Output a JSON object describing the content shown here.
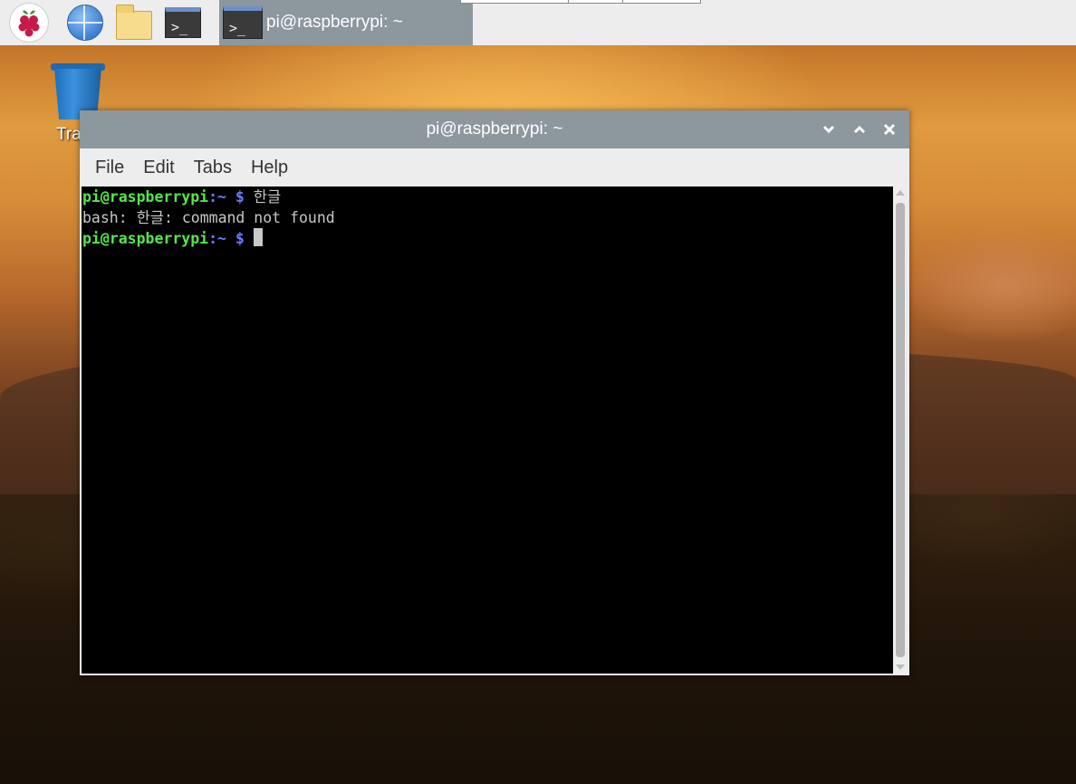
{
  "taskbar": {
    "launchers": [
      {
        "name": "raspberry-menu",
        "icon": "raspberry-pi-logo-icon"
      },
      {
        "name": "web-browser",
        "icon": "globe-icon"
      },
      {
        "name": "file-manager",
        "icon": "folder-icon"
      },
      {
        "name": "terminal",
        "icon": "terminal-icon",
        "glyph": ">_"
      }
    ],
    "task": {
      "label": "pi@raspberrypi: ~",
      "glyph": ">_"
    }
  },
  "desktop": {
    "trash_label": "Tra"
  },
  "window": {
    "title": "pi@raspberrypi: ~",
    "controls": {
      "minimize": "⌄",
      "maximize": "⌃",
      "close": "✕"
    },
    "menu": [
      "File",
      "Edit",
      "Tabs",
      "Help"
    ]
  },
  "terminal": {
    "lines": [
      {
        "user": "pi@raspberrypi",
        "sep": ":",
        "path": "~",
        "sym": " $",
        "cmd": " 한글"
      },
      {
        "output": "bash: 한글: command not found"
      },
      {
        "user": "pi@raspberrypi",
        "sep": ":",
        "path": "~",
        "sym": " $",
        "cmd": " "
      }
    ]
  },
  "colors": {
    "titlebar": "#8c979e",
    "prompt_user": "#55e64a",
    "prompt_path": "#6b7cff",
    "terminal_bg": "#000000"
  }
}
